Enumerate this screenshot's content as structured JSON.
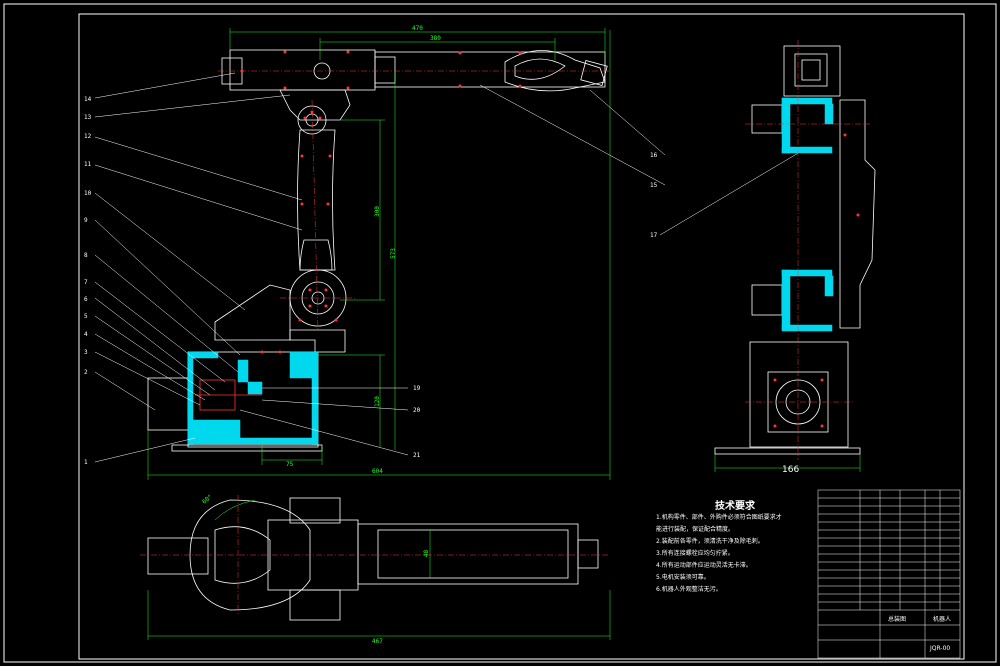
{
  "callouts_left": [
    "14",
    "13",
    "12",
    "11",
    "10",
    "9",
    "8",
    "7",
    "6",
    "5",
    "4",
    "3",
    "2",
    "1"
  ],
  "callouts_right": [
    "19",
    "20",
    "21",
    "16",
    "15"
  ],
  "callout_17": "17",
  "dims": {
    "top_total": "470",
    "top_inner": "380",
    "vert_arm": "300",
    "vert_total": "573",
    "vert_base": "120",
    "base_small": "75",
    "base_width": "604",
    "side_width": "166",
    "plan_width": "467",
    "plan_height": "48",
    "plan_angle": "60°"
  },
  "tech_requirements": {
    "title": "技术要求",
    "items": [
      "1.机构零件、部件、外购件必须符合图纸要求才",
      "能进行装配，保证配合精度。",
      "2.装配前各零件，须清洗干净及除毛刺。",
      "3.所有连接螺栓应均匀拧紧。",
      "4.所有运动部件应运动灵活无卡滞。",
      "5.电机安装须可靠。",
      "6.机器人外观整洁无污。"
    ]
  },
  "title_block": {
    "drawing_name": "机器人",
    "sheet_label": "总装图",
    "code": "JQR-00"
  },
  "colors": {
    "outline": "#ffffff",
    "centerline": "#ff3333",
    "dimension": "#22ff22",
    "section": "#00e5ff",
    "border": "#ffffff"
  }
}
